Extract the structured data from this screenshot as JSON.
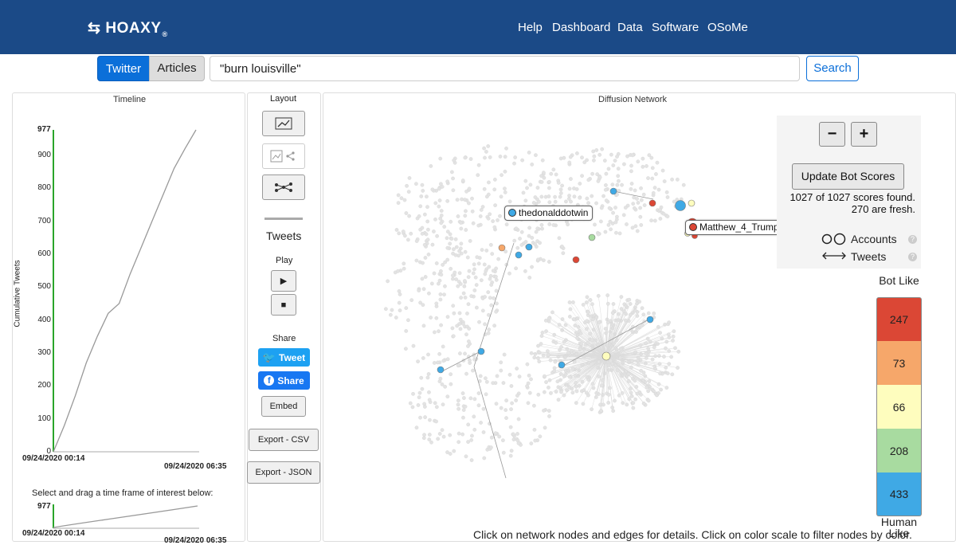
{
  "brand": {
    "name": "HOAXY",
    "mark": "®"
  },
  "nav": {
    "help": "Help",
    "dashboard": "Dashboard",
    "data": "Data",
    "software": "Software",
    "osome": "OSoMe"
  },
  "search": {
    "twitter_tab": "Twitter",
    "articles_tab": "Articles",
    "query": "\"burn louisville\"",
    "button": "Search"
  },
  "timeline": {
    "title": "Timeline",
    "ylabel": "Cumulative Tweets",
    "max_label": "977",
    "yticks": [
      "900",
      "800",
      "700",
      "600",
      "500",
      "400",
      "300",
      "200",
      "100",
      "0"
    ],
    "start": "09/24/2020 00:14",
    "end": "09/24/2020 06:35",
    "select_hint": "Select and drag a time frame of interest below:",
    "mini_max": "977",
    "mini_start": "09/24/2020 00:14",
    "mini_end": "09/24/2020 06:35"
  },
  "controls": {
    "layout": "Layout",
    "tweets": "Tweets",
    "play": "Play",
    "share": "Share",
    "tweet_btn": "Tweet",
    "share_btn": "Share",
    "embed": "Embed",
    "export_csv": "Export - CSV",
    "export_json": "Export - JSON"
  },
  "network": {
    "title": "Diffusion Network",
    "label1": "thedonalddotwin",
    "label2": "Matthew_4_Trump",
    "zoom_out": "−",
    "zoom_in": "+",
    "update": "Update Bot Scores",
    "scores_found": "1027 of 1027 scores found.",
    "fresh": "270 are fresh.",
    "accounts": "Accounts",
    "tweets": "Tweets",
    "bot_like": "Bot Like",
    "human_like": "Human Like",
    "scale": [
      {
        "value": "247",
        "color": "#db4735"
      },
      {
        "value": "73",
        "color": "#f6a76a"
      },
      {
        "value": "66",
        "color": "#fefdbe"
      },
      {
        "value": "208",
        "color": "#a8dba0"
      },
      {
        "value": "433",
        "color": "#3fa9e5"
      }
    ],
    "footer": "Click on network nodes and edges for details. Click on color scale to filter nodes by color."
  },
  "chart_data": {
    "type": "line",
    "xlabel": "",
    "ylabel": "Cumulative Tweets",
    "ylim": [
      0,
      977
    ],
    "x": [
      "00:14",
      "00:30",
      "01:00",
      "01:30",
      "02:00",
      "02:30",
      "03:00",
      "03:30",
      "04:00",
      "04:30",
      "05:00",
      "05:30",
      "06:00",
      "06:35"
    ],
    "series": [
      {
        "values": [
          0,
          80,
          170,
          270,
          350,
          420,
          450,
          540,
          620,
          700,
          780,
          860,
          920,
          977
        ]
      }
    ]
  }
}
